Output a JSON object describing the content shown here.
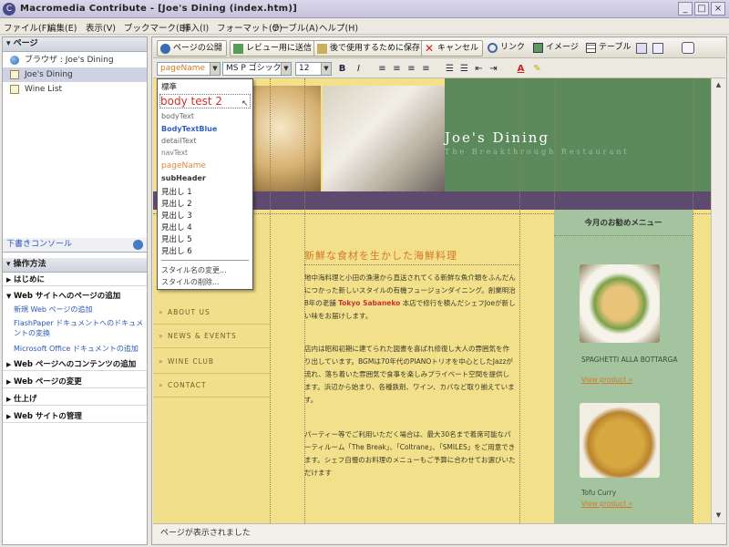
{
  "window": {
    "title": "Macromedia Contribute - [Joe's Dining (index.htm)]",
    "app_icon": "contribute-icon",
    "controls": [
      "_",
      "□",
      "×"
    ]
  },
  "menu": [
    "ファイル(F)",
    "編集(E)",
    "表示(V)",
    "ブックマーク(B)",
    "挿入(I)",
    "フォーマット(O)",
    "テーブル(A)",
    "ヘルプ(H)"
  ],
  "left": {
    "pages_header": "ページ",
    "pages": [
      {
        "label": "ブラウザ : Joe's Dining",
        "icon": "globe-icon"
      },
      {
        "label": "Joe's Dining",
        "icon": "page-icon",
        "selected": true
      },
      {
        "label": "Wine List",
        "icon": "page-icon"
      }
    ],
    "drafts_console": "下書きコンソール",
    "howto_header": "操作方法",
    "tasks": [
      {
        "label": "はじめに",
        "expanded": false
      },
      {
        "label": "Web サイトへのページの追加",
        "expanded": true,
        "subitems": [
          "新規 Web ページの追加",
          "FlashPaper ドキュメントへのドキュメントの変換",
          "Microsoft Office ドキュメントの追加"
        ]
      },
      {
        "label": "Web ページへのコンテンツの追加",
        "expanded": false
      },
      {
        "label": "Web ページの変更",
        "expanded": false
      },
      {
        "label": "仕上げ",
        "expanded": false
      },
      {
        "label": "Web サイトの管理",
        "expanded": false
      }
    ]
  },
  "toolbar1": {
    "publish": "ページの公開",
    "review": "レビュー用に送信",
    "save_later": "後で使用するために保存",
    "cancel": "キャンセル",
    "link": "リンク",
    "image": "イメージ",
    "table": "テーブル"
  },
  "toolbar2": {
    "style_value": "pageName",
    "font_value": "MS P ゴシック",
    "size_value": "12",
    "bold": "B",
    "italic": "I"
  },
  "style_dropdown": {
    "items": [
      {
        "label": "標準",
        "style": "normal"
      },
      {
        "label": "body test 2",
        "style": "big-red"
      },
      {
        "label": "bodyText",
        "style": "gray"
      },
      {
        "label": "BodyTextBlue",
        "style": "blue"
      },
      {
        "label": "detailText",
        "style": "gray"
      },
      {
        "label": "navText",
        "style": "gray"
      },
      {
        "label": "pageName",
        "style": "orange"
      },
      {
        "label": "subHeader",
        "style": "bold"
      },
      {
        "label": "見出し 1",
        "style": "normal"
      },
      {
        "label": "見出し 2",
        "style": "normal"
      },
      {
        "label": "見出し 3",
        "style": "normal"
      },
      {
        "label": "見出し 4",
        "style": "normal"
      },
      {
        "label": "見出し 5",
        "style": "normal"
      },
      {
        "label": "見出し 6",
        "style": "normal"
      }
    ],
    "edit_styles": "スタイル名の変更...",
    "delete_style": "スタイルの削除..."
  },
  "site": {
    "logo": "Joe's Dining",
    "tagline": "The Breakthrough Restaurant",
    "nav": [
      "ABOUT US",
      "NEWS & EVENTS",
      "WINE CLUB",
      "CONTACT"
    ],
    "headline": "新鮮な食材を生かした海鮮料理",
    "para1a": "地中海料理と小田の漁港から直送されてくる新鮮な魚介類をふんだんにつかった新しいスタイルの有機フュージョンダイニング。創業明治8年の老舗 ",
    "para1_highlight": "Tokyo Sabaneko",
    "para1b": " 本店で修行を積んだシェフJoeが新しい味をお届けします。",
    "para2": "店内は昭和初期に建てられた図書を喜ばれ修復し大人の雰囲気を作り出しています。BGMは70年代のPIANOトリオを中心としたJazzが流れ、落ち着いた雰囲気で食事を楽しみプライベート空間を提供します。浜辺から始まり、各種鉄剤、ワイン、カバなど取り揃えています。",
    "para3": "パーティー等でご利用いただく場合は、最大30名まで着席可能なパーティルーム「The Break」、「Coltrane」、「SMILES」をご用意できます。シェフ自慢のお料理のメニューもご予算に合わせてお選びいただけます",
    "recommend_title": "今月のお勧めメニュー",
    "items": [
      {
        "name": "SPAGHETTI ALLA BOTTARGA",
        "link": "View product »"
      },
      {
        "name": "Tofu Curry",
        "link": "View product »"
      }
    ]
  },
  "status": "ページが表示されました",
  "colors": {
    "header_green": "#5c8a5c",
    "nav_purple": "#5e4a6e",
    "page_yellow": "#f2e08a",
    "recommend_green": "#a4c4a0",
    "highlight_red": "#cc3333",
    "link_orange": "#d47a22"
  }
}
